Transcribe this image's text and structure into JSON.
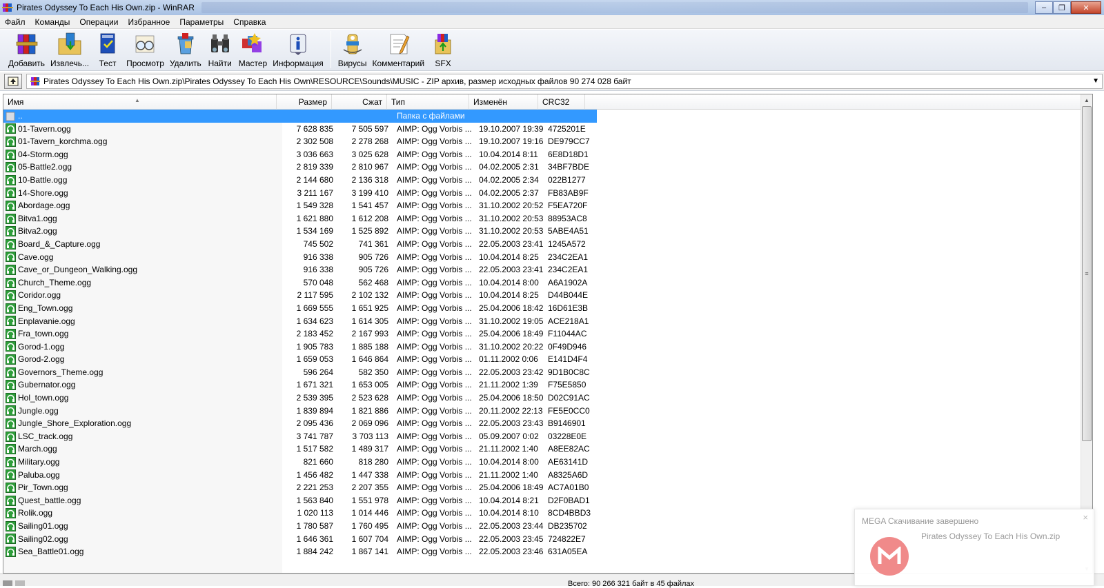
{
  "window": {
    "title": "Pirates Odyssey To Each His Own.zip - WinRAR",
    "controls": [
      "–",
      "❐",
      "✕"
    ]
  },
  "menu": [
    "Файл",
    "Команды",
    "Операции",
    "Избранное",
    "Параметры",
    "Справка"
  ],
  "toolbar": [
    {
      "label": "Добавить",
      "icon": "books-add-icon"
    },
    {
      "label": "Извлечь...",
      "icon": "extract-folder-icon"
    },
    {
      "label": "Тест",
      "icon": "test-book-icon"
    },
    {
      "label": "Просмотр",
      "icon": "view-glasses-icon"
    },
    {
      "label": "Удалить",
      "icon": "delete-trash-icon"
    },
    {
      "label": "Найти",
      "icon": "find-binoculars-icon"
    },
    {
      "label": "Мастер",
      "icon": "wizard-icon"
    },
    {
      "label": "Информация",
      "icon": "info-icon"
    },
    {
      "label": "Вирусы",
      "icon": "virus-scan-icon"
    },
    {
      "label": "Комментарий",
      "icon": "comment-icon"
    },
    {
      "label": "SFX",
      "icon": "sfx-box-icon"
    }
  ],
  "path": "Pirates Odyssey To Each His Own.zip\\Pirates Odyssey To Each His Own\\RESOURCE\\Sounds\\MUSIC - ZIP архив, размер исходных файлов 90 274 028 байт",
  "columns": {
    "name": "Имя",
    "size": "Размер",
    "packed": "Сжат",
    "type": "Тип",
    "modified": "Изменён",
    "crc": "CRC32"
  },
  "parent_row": {
    "name": "..",
    "type": "Папка с файлами"
  },
  "files": [
    {
      "name": "01-Tavern.ogg",
      "size": "7 628 835",
      "packed": "7 505 597",
      "type": "AIMP: Ogg Vorbis ...",
      "modified": "19.10.2007 19:39",
      "crc": "4725201E"
    },
    {
      "name": "01-Tavern_korchma.ogg",
      "size": "2 302 508",
      "packed": "2 278 268",
      "type": "AIMP: Ogg Vorbis ...",
      "modified": "19.10.2007 19:16",
      "crc": "DE979CC7"
    },
    {
      "name": "04-Storm.ogg",
      "size": "3 036 663",
      "packed": "3 025 628",
      "type": "AIMP: Ogg Vorbis ...",
      "modified": "10.04.2014 8:11",
      "crc": "6E8D18D1"
    },
    {
      "name": "05-Battle2.ogg",
      "size": "2 819 339",
      "packed": "2 810 967",
      "type": "AIMP: Ogg Vorbis ...",
      "modified": "04.02.2005 2:31",
      "crc": "34BF7BDE"
    },
    {
      "name": "10-Battle.ogg",
      "size": "2 144 680",
      "packed": "2 136 318",
      "type": "AIMP: Ogg Vorbis ...",
      "modified": "04.02.2005 2:34",
      "crc": "022B1277"
    },
    {
      "name": "14-Shore.ogg",
      "size": "3 211 167",
      "packed": "3 199 410",
      "type": "AIMP: Ogg Vorbis ...",
      "modified": "04.02.2005 2:37",
      "crc": "FB83AB9F"
    },
    {
      "name": "Abordage.ogg",
      "size": "1 549 328",
      "packed": "1 541 457",
      "type": "AIMP: Ogg Vorbis ...",
      "modified": "31.10.2002 20:52",
      "crc": "F5EA720F"
    },
    {
      "name": "Bitva1.ogg",
      "size": "1 621 880",
      "packed": "1 612 208",
      "type": "AIMP: Ogg Vorbis ...",
      "modified": "31.10.2002 20:53",
      "crc": "88953AC8"
    },
    {
      "name": "Bitva2.ogg",
      "size": "1 534 169",
      "packed": "1 525 892",
      "type": "AIMP: Ogg Vorbis ...",
      "modified": "31.10.2002 20:53",
      "crc": "5ABE4A51"
    },
    {
      "name": "Board_&_Capture.ogg",
      "size": "745 502",
      "packed": "741 361",
      "type": "AIMP: Ogg Vorbis ...",
      "modified": "22.05.2003 23:41",
      "crc": "1245A572"
    },
    {
      "name": "Cave.ogg",
      "size": "916 338",
      "packed": "905 726",
      "type": "AIMP: Ogg Vorbis ...",
      "modified": "10.04.2014 8:25",
      "crc": "234C2EA1"
    },
    {
      "name": "Cave_or_Dungeon_Walking.ogg",
      "size": "916 338",
      "packed": "905 726",
      "type": "AIMP: Ogg Vorbis ...",
      "modified": "22.05.2003 23:41",
      "crc": "234C2EA1"
    },
    {
      "name": "Church_Theme.ogg",
      "size": "570 048",
      "packed": "562 468",
      "type": "AIMP: Ogg Vorbis ...",
      "modified": "10.04.2014 8:00",
      "crc": "A6A1902A"
    },
    {
      "name": "Coridor.ogg",
      "size": "2 117 595",
      "packed": "2 102 132",
      "type": "AIMP: Ogg Vorbis ...",
      "modified": "10.04.2014 8:25",
      "crc": "D44B044E"
    },
    {
      "name": "Eng_Town.ogg",
      "size": "1 669 555",
      "packed": "1 651 925",
      "type": "AIMP: Ogg Vorbis ...",
      "modified": "25.04.2006 18:42",
      "crc": "16D61E3B"
    },
    {
      "name": "Enplavanie.ogg",
      "size": "1 634 623",
      "packed": "1 614 305",
      "type": "AIMP: Ogg Vorbis ...",
      "modified": "31.10.2002 19:05",
      "crc": "ACE218A1"
    },
    {
      "name": "Fra_town.ogg",
      "size": "2 183 452",
      "packed": "2 167 993",
      "type": "AIMP: Ogg Vorbis ...",
      "modified": "25.04.2006 18:49",
      "crc": "F11044AC"
    },
    {
      "name": "Gorod-1.ogg",
      "size": "1 905 783",
      "packed": "1 885 188",
      "type": "AIMP: Ogg Vorbis ...",
      "modified": "31.10.2002 20:22",
      "crc": "0F49D946"
    },
    {
      "name": "Gorod-2.ogg",
      "size": "1 659 053",
      "packed": "1 646 864",
      "type": "AIMP: Ogg Vorbis ...",
      "modified": "01.11.2002 0:06",
      "crc": "E141D4F4"
    },
    {
      "name": "Governors_Theme.ogg",
      "size": "596 264",
      "packed": "582 350",
      "type": "AIMP: Ogg Vorbis ...",
      "modified": "22.05.2003 23:42",
      "crc": "9D1B0C8C"
    },
    {
      "name": "Gubernator.ogg",
      "size": "1 671 321",
      "packed": "1 653 005",
      "type": "AIMP: Ogg Vorbis ...",
      "modified": "21.11.2002 1:39",
      "crc": "F75E5850"
    },
    {
      "name": "Hol_town.ogg",
      "size": "2 539 395",
      "packed": "2 523 628",
      "type": "AIMP: Ogg Vorbis ...",
      "modified": "25.04.2006 18:50",
      "crc": "D02C91AC"
    },
    {
      "name": "Jungle.ogg",
      "size": "1 839 894",
      "packed": "1 821 886",
      "type": "AIMP: Ogg Vorbis ...",
      "modified": "20.11.2002 22:13",
      "crc": "FE5E0CC0"
    },
    {
      "name": "Jungle_Shore_Exploration.ogg",
      "size": "2 095 436",
      "packed": "2 069 096",
      "type": "AIMP: Ogg Vorbis ...",
      "modified": "22.05.2003 23:43",
      "crc": "B9146901"
    },
    {
      "name": "LSC_track.ogg",
      "size": "3 741 787",
      "packed": "3 703 113",
      "type": "AIMP: Ogg Vorbis ...",
      "modified": "05.09.2007 0:02",
      "crc": "03228E0E"
    },
    {
      "name": "March.ogg",
      "size": "1 517 582",
      "packed": "1 489 317",
      "type": "AIMP: Ogg Vorbis ...",
      "modified": "21.11.2002 1:40",
      "crc": "A8EE82AC"
    },
    {
      "name": "Military.ogg",
      "size": "821 660",
      "packed": "818 280",
      "type": "AIMP: Ogg Vorbis ...",
      "modified": "10.04.2014 8:00",
      "crc": "AE63141D"
    },
    {
      "name": "Paluba.ogg",
      "size": "1 456 482",
      "packed": "1 447 338",
      "type": "AIMP: Ogg Vorbis ...",
      "modified": "21.11.2002 1:40",
      "crc": "A8325A6D"
    },
    {
      "name": "Pir_Town.ogg",
      "size": "2 221 253",
      "packed": "2 207 355",
      "type": "AIMP: Ogg Vorbis ...",
      "modified": "25.04.2006 18:49",
      "crc": "AC7A01B0"
    },
    {
      "name": "Quest_battle.ogg",
      "size": "1 563 840",
      "packed": "1 551 978",
      "type": "AIMP: Ogg Vorbis ...",
      "modified": "10.04.2014 8:21",
      "crc": "D2F0BAD1"
    },
    {
      "name": "Rolik.ogg",
      "size": "1 020 113",
      "packed": "1 014 446",
      "type": "AIMP: Ogg Vorbis ...",
      "modified": "10.04.2014 8:10",
      "crc": "8CD4BBD3"
    },
    {
      "name": "Sailing01.ogg",
      "size": "1 780 587",
      "packed": "1 760 495",
      "type": "AIMP: Ogg Vorbis ...",
      "modified": "22.05.2003 23:44",
      "crc": "DB235702"
    },
    {
      "name": "Sailing02.ogg",
      "size": "1 646 361",
      "packed": "1 607 704",
      "type": "AIMP: Ogg Vorbis ...",
      "modified": "22.05.2003 23:45",
      "crc": "724822E7"
    },
    {
      "name": "Sea_Battle01.ogg",
      "size": "1 884 242",
      "packed": "1 867 141",
      "type": "AIMP: Ogg Vorbis ...",
      "modified": "22.05.2003 23:46",
      "crc": "631A05EA"
    }
  ],
  "status": "Всего: 90 266 321 байт в 45 файлах",
  "toast": {
    "title": "MEGA Скачивание завершено",
    "file": "Pirates Odyssey To Each His Own.zip",
    "close": "×"
  },
  "colors": {
    "selection": "#3399ff",
    "file_icon": "#2e9e3a",
    "mega_logo": "#f08a8a"
  }
}
